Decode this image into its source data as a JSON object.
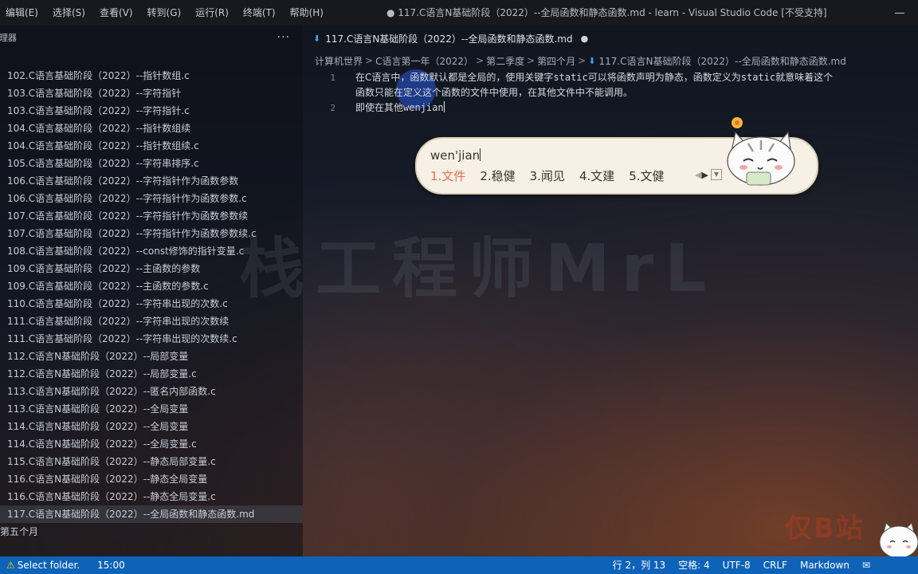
{
  "menu": {
    "items": [
      "编辑(E)",
      "选择(S)",
      "查看(V)",
      "转到(G)",
      "运行(R)",
      "终端(T)",
      "帮助(H)"
    ]
  },
  "window": {
    "title": "● 117.C语言N基础阶段（2022）--全局函数和静态函数.md - learn - Visual Studio Code [不受支持]"
  },
  "explorer": {
    "title": "源管理器",
    "title_visible": "理器",
    "more": "···",
    "files": [
      "102.C语言基础阶段（2022）--指针数组.c",
      "103.C语言基础阶段（2022）--字符指针",
      "103.C语言基础阶段（2022）--字符指针.c",
      "104.C语言基础阶段（2022）--指针数组续",
      "104.C语言基础阶段（2022）--指针数组续.c",
      "105.C语言基础阶段（2022）--字符串排序.c",
      "106.C语言基础阶段（2022）--字符指针作为函数参数",
      "106.C语言基础阶段（2022）--字符指针作为函数参数.c",
      "107.C语言基础阶段（2022）--字符指针作为函数参数续",
      "107.C语言基础阶段（2022）--字符指针作为函数参数续.c",
      "108.C语言基础阶段（2022）--const修饰的指针变量.c",
      "109.C语言基础阶段（2022）--主函数的参数",
      "109.C语言基础阶段（2022）--主函数的参数.c",
      "110.C语言基础阶段（2022）--字符串出现的次数.c",
      "111.C语言基础阶段（2022）--字符串出现的次数续",
      "111.C语言基础阶段（2022）--字符串出现的次数续.c",
      "112.C语言N基础阶段（2022）--局部变量",
      "112.C语言N基础阶段（2022）--局部变量.c",
      "113.C语言N基础阶段（2022）--匿名内部函数.c",
      "113.C语言N基础阶段（2022）--全局变量",
      "114.C语言N基础阶段（2022）--全局变量",
      "114.C语言N基础阶段（2022）--全局变量.c",
      "115.C语言N基础阶段（2022）--静态局部变量.c",
      "116.C语言N基础阶段（2022）--静态全局变量",
      "116.C语言N基础阶段（2022）--静态全局变量.c",
      "117.C语言N基础阶段（2022）--全局函数和静态函数.md"
    ],
    "selected_index": 25,
    "folder": "第五个月"
  },
  "tab": {
    "label": "117.C语言N基础阶段（2022）--全局函数和静态函数.md",
    "dirty": "●"
  },
  "breadcrumb": [
    "计算机世界",
    "C语言第一年（2022）",
    "第二季度",
    "第四个月",
    "117.C语言N基础阶段（2022）--全局函数和静态函数.md"
  ],
  "editor": {
    "line1_num": "1",
    "line1_a": "在C语言中，函数默认都是全局的，使用关键字",
    "line1_kw1": "static",
    "line1_b": "可以将函数声明为静态，函数定义为",
    "line1_kw2": "static",
    "line1_c": "就意味着这个",
    "line1_wrap": "函数只能在定义这个函数的文件中使用，在其他文件中不能调用。",
    "line2_num": "2",
    "line2_a": "即使在其他",
    "line2_b": "wenjian"
  },
  "watermark": "栈工程师MrL",
  "ime": {
    "input": "wen'jian",
    "candidates": [
      "1.文件",
      "2.稳健",
      "3.闻见",
      "4.文建",
      "5.文健"
    ]
  },
  "brand_text": "仅B站",
  "status": {
    "warning": "Select folder.",
    "time": "15:00",
    "position": "行 2，列 13",
    "spaces": "空格: 4",
    "encoding": "UTF-8",
    "eol": "CRLF",
    "language": "Markdown"
  },
  "colors": {
    "statusbar": "#0e63b8",
    "ime_bg": "#f6f1e4",
    "ime_first_candidate": "#e86a5c",
    "md_icon": "#4aa3e8"
  }
}
